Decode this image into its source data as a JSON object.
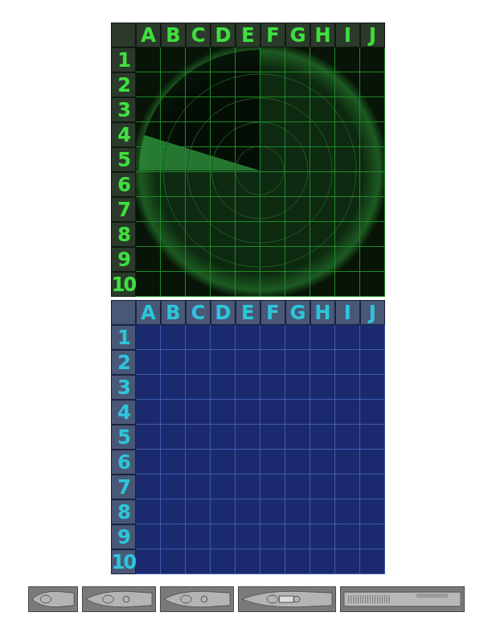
{
  "radar_board": {
    "columns": [
      "A",
      "B",
      "C",
      "D",
      "E",
      "F",
      "G",
      "H",
      "I",
      "J"
    ],
    "rows": [
      "1",
      "2",
      "3",
      "4",
      "5",
      "6",
      "7",
      "8",
      "9",
      "10"
    ]
  },
  "ocean_board": {
    "columns": [
      "A",
      "B",
      "C",
      "D",
      "E",
      "F",
      "G",
      "H",
      "I",
      "J"
    ],
    "rows": [
      "1",
      "2",
      "3",
      "4",
      "5",
      "6",
      "7",
      "8",
      "9",
      "10"
    ]
  },
  "fleet": [
    {
      "kind": "patrol"
    },
    {
      "kind": "destroyer"
    },
    {
      "kind": "submarine"
    },
    {
      "kind": "battleship"
    },
    {
      "kind": "carrier"
    }
  ]
}
